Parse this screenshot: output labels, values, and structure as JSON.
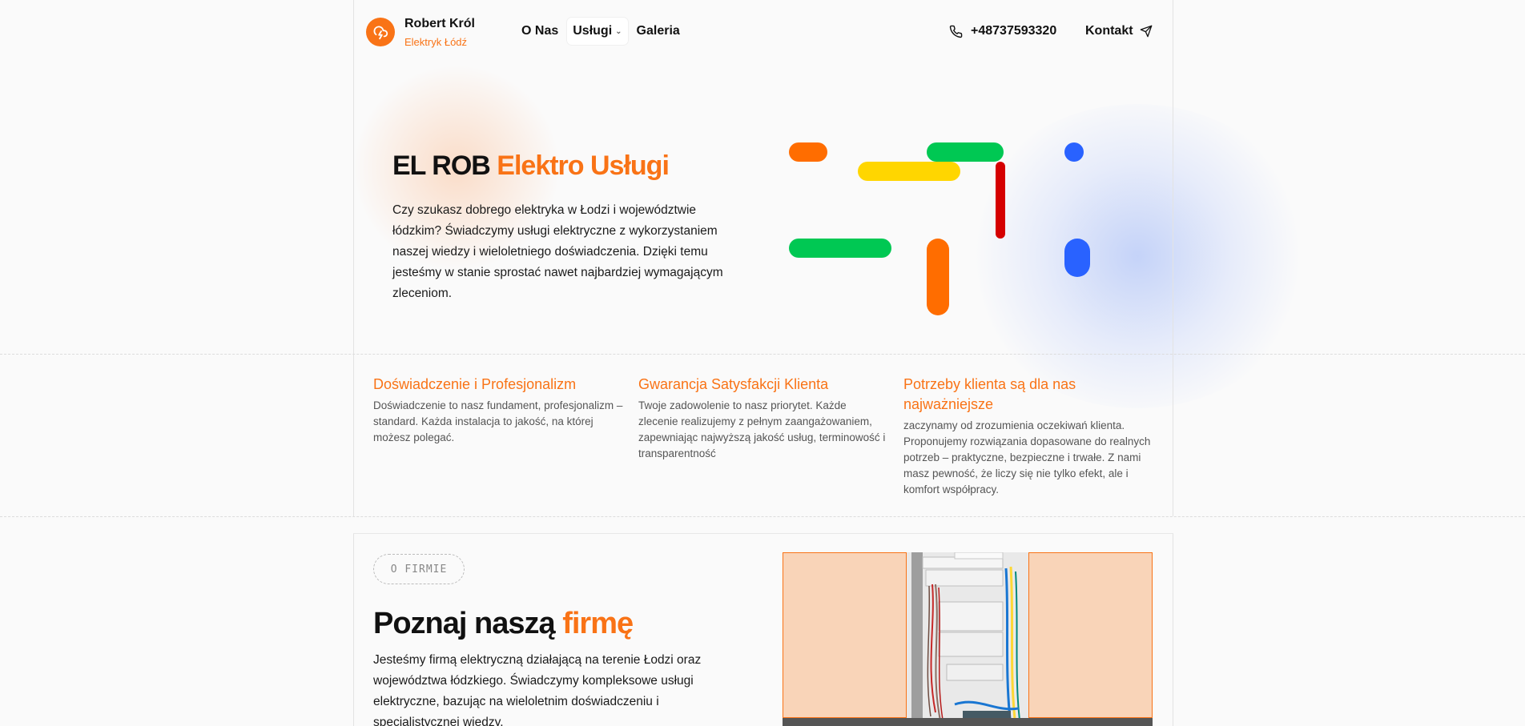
{
  "header": {
    "brand_name": "Robert Król",
    "brand_sub": "Elektryk Łódź",
    "nav": [
      {
        "label": "O Nas"
      },
      {
        "label": "Usługi"
      },
      {
        "label": "Galeria"
      }
    ],
    "phone": "+48737593320",
    "contact_label": "Kontakt"
  },
  "hero": {
    "title_main": "EL ROB",
    "title_accent": "Elektro Usługi",
    "text": "Czy szukasz dobrego elektryka w Łodzi i województwie łódzkim? Świadczymy usługi elektryczne z wykorzystaniem naszej wiedzy i wieloletniego doświadczenia. Dzięki temu jesteśmy w stanie sprostać nawet najbardziej wymagającym zleceniom."
  },
  "features": [
    {
      "title": "Doświadczenie i Profesjonalizm",
      "text": "Doświadczenie to nasz fundament, profesjonalizm – standard. Każda instalacja to jakość, na której możesz polegać."
    },
    {
      "title": "Gwarancja Satysfakcji Klienta",
      "text": "Twoje zadowolenie to nasz priorytet. Każde zlecenie realizujemy z pełnym zaangażowaniem, zapewniając najwyższą jakość usług, terminowość i transparentność"
    },
    {
      "title": "Potrzeby klienta są dla nas najważniejsze",
      "text": "zaczynamy od zrozumienia oczekiwań klienta. Proponujemy rozwiązania dopasowane do realnych potrzeb – praktyczne, bezpieczne i trwałe. Z nami masz pewność, że liczy się nie tylko efekt, ale i komfort współpracy."
    }
  ],
  "about": {
    "badge": "O FIRMIE",
    "title_main": "Poznaj naszą",
    "title_accent": "firmę",
    "text": "Jesteśmy firmą elektryczną działającą na terenie Łodzi oraz województwa łódzkiego. Świadczymy kompleksowe usługi elektryczne, bazując na wieloletnim doświadczeniu i specjalistycznej wiedzy."
  },
  "colors": {
    "accent": "#f97316",
    "green": "#00c853",
    "yellow": "#ffd600",
    "red": "#d50000",
    "blue": "#2962ff"
  }
}
